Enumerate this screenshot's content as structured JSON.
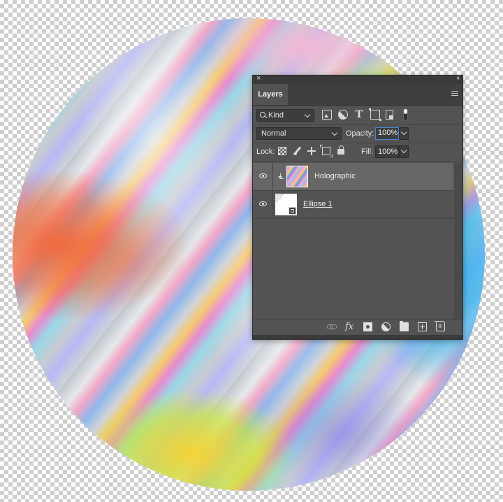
{
  "canvas": {
    "artwork": "holographic-ellipse",
    "background": "transparency-checkerboard"
  },
  "panel": {
    "close_glyph": "×",
    "collapse_glyph": "‹‹",
    "tab_label": "Layers",
    "menu_icon": "hamburger-icon",
    "filter": {
      "kind_label": "Kind",
      "icons": [
        "pixel-layer-filter-icon",
        "adjustment-layer-filter-icon",
        "type-layer-filter-icon",
        "shape-layer-filter-icon",
        "smart-object-filter-icon"
      ]
    },
    "blend": {
      "mode": "Normal",
      "opacity_label": "Opacity:",
      "opacity_value": "100%"
    },
    "lock": {
      "label": "Lock:",
      "fill_label": "Fill:",
      "fill_value": "100%"
    },
    "layers": [
      {
        "name": "Holographic",
        "selected": true,
        "visible": true,
        "clipping_mask": true
      },
      {
        "name": "Ellipse 1",
        "selected": false,
        "visible": true,
        "clipping_mask": false
      }
    ],
    "accent_color": "#4a83d4",
    "panel_color": "#535353",
    "selected_row_color": "#666666"
  }
}
